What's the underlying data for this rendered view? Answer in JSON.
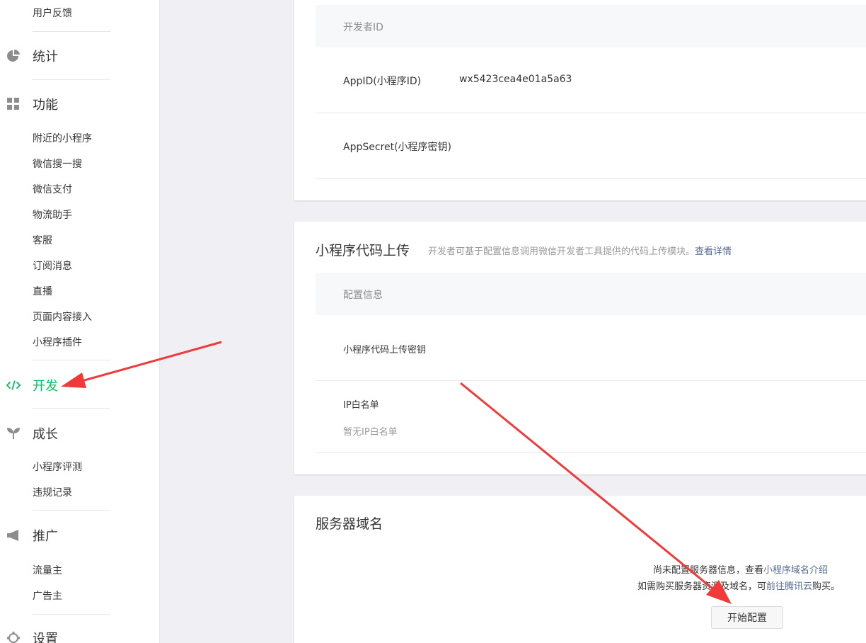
{
  "sidebar": {
    "top_item": "用户反馈",
    "stats": "统计",
    "features": "功能",
    "feature_items": [
      "附近的小程序",
      "微信搜一搜",
      "微信支付",
      "物流助手",
      "客服",
      "订阅消息",
      "直播",
      "页面内容接入",
      "小程序插件"
    ],
    "develop": "开发",
    "growth": "成长",
    "growth_items": [
      "小程序评测",
      "违规记录"
    ],
    "promote": "推广",
    "promote_items": [
      "流量主",
      "广告主"
    ],
    "settings": "设置"
  },
  "developer_id": {
    "header": "开发者ID",
    "appid_label": "AppID(小程序ID)",
    "appid_value": "wx5423cea4e01a5a63",
    "appsecret_label": "AppSecret(小程序密钥)"
  },
  "code_upload": {
    "title": "小程序代码上传",
    "desc": "开发者可基于配置信息调用微信开发者工具提供的代码上传模块。",
    "desc_link": "查看详情",
    "header": "配置信息",
    "key_label": "小程序代码上传密钥",
    "ip_label": "IP白名单",
    "ip_empty": "暂无IP白名单"
  },
  "server_domain": {
    "title": "服务器域名",
    "line1_text": "尚未配置服务器信息，查看",
    "line1_link": "小程序域名介绍",
    "line2_text": "如需购买服务器资源及域名，可",
    "line2_link": "前往腾讯云",
    "line2_tail": "购买。",
    "start_button": "开始配置"
  },
  "colors": {
    "accent_green": "#07c160",
    "link_blue": "#576b95",
    "arrow_red": "#f03a3a"
  }
}
